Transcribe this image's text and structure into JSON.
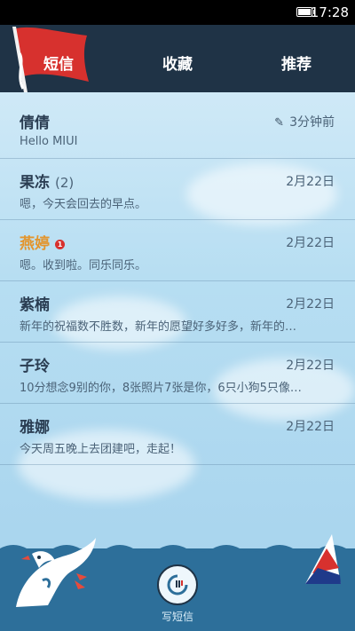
{
  "status": {
    "time": "17:28"
  },
  "tabs": [
    {
      "label": "短信"
    },
    {
      "label": "收藏"
    },
    {
      "label": "推荐"
    }
  ],
  "messages": [
    {
      "name": "倩倩",
      "date": "3分钟前",
      "preview": "Hello MIUI",
      "draft": true
    },
    {
      "name": "果冻",
      "count": "(2)",
      "date": "2月22日",
      "preview": "嗯，今天会回去的早点。"
    },
    {
      "name": "燕婷",
      "badge": "1",
      "date": "2月22日",
      "preview": "嗯。收到啦。同乐同乐。",
      "unread": true
    },
    {
      "name": "紫楠",
      "date": "2月22日",
      "preview": "新年的祝福数不胜数，新年的愿望好多好多，新年的…"
    },
    {
      "name": "子玲",
      "date": "2月22日",
      "preview": "10分想念9别的你，8张照片7张是你，6只小狗5只像…"
    },
    {
      "name": "雅娜",
      "date": "2月22日",
      "preview": "今天周五晚上去团建吧，走起！"
    }
  ],
  "compose": {
    "label": "写短信"
  },
  "colors": {
    "header": "#1f3346",
    "unread_name": "#e3952d",
    "sea": "#2d6f9a",
    "flag": "#d7312e"
  }
}
